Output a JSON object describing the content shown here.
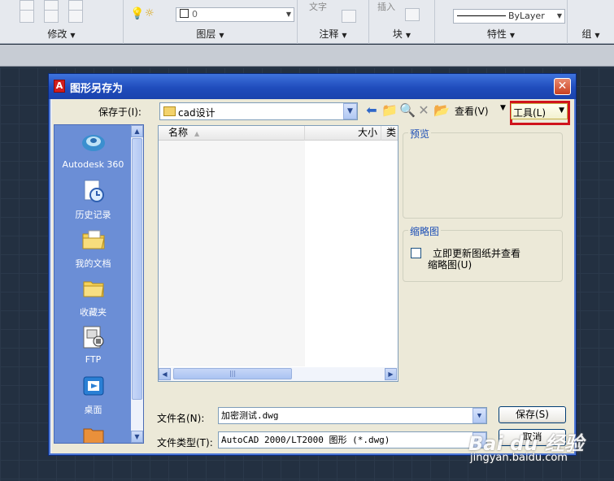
{
  "ribbon": {
    "panels": [
      "修改",
      "图层",
      "注释",
      "块",
      "特性",
      "组"
    ],
    "layer_value": "0",
    "text_label": "文字",
    "insert_label": "插入",
    "bylayer_label": "ByLayer"
  },
  "dialog": {
    "title": "图形另存为",
    "close_label": "✕",
    "save_in_label": "保存于(I):",
    "save_in_value": "cad设计",
    "view_label": "查看(V)",
    "tools_label": "工具(L)",
    "places": [
      {
        "label": "Autodesk 360",
        "icon": "cloud-icon"
      },
      {
        "label": "历史记录",
        "icon": "history-icon"
      },
      {
        "label": "我的文档",
        "icon": "documents-icon"
      },
      {
        "label": "收藏夹",
        "icon": "favorites-icon"
      },
      {
        "label": "FTP",
        "icon": "ftp-icon"
      },
      {
        "label": "桌面",
        "icon": "desktop-icon"
      }
    ],
    "columns": {
      "name": "名称",
      "size": "大小",
      "type": "类"
    },
    "preview_label": "预览",
    "thumbnail_label": "缩略图",
    "update_thumb_label_1": "立即更新图纸并查看",
    "update_thumb_label_2": "缩略图(U)",
    "filename_label": "文件名(N):",
    "filename_value": "加密测试.dwg",
    "filetype_label": "文件类型(T):",
    "filetype_value": "AutoCAD 2000/LT2000 图形 (*.dwg)",
    "save_button": "保存(S)",
    "cancel_button": "取消"
  },
  "watermark": {
    "logo": "Bai du 经验",
    "url": "jingyan.baidu.com"
  }
}
